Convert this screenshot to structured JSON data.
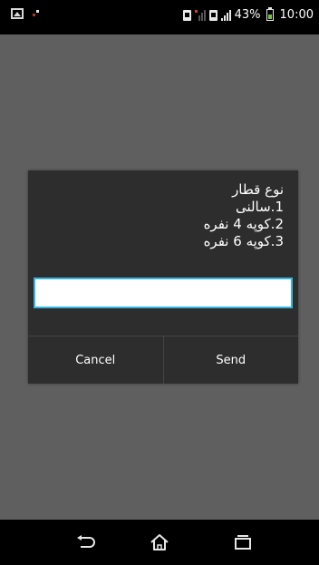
{
  "status_bar": {
    "battery": "43%",
    "time": "10:00",
    "icons": [
      "gallery-icon",
      "notification-icon",
      "sim-icon",
      "signal-icon",
      "battery-icon"
    ]
  },
  "dialog": {
    "message_lines": [
      "نوع قطار",
      "1.سالنی",
      "2.کوپه 4 نفره",
      "3.کوپه 6 نفره"
    ],
    "input": {
      "value": "",
      "placeholder": ""
    },
    "buttons": {
      "cancel": "Cancel",
      "send": "Send"
    },
    "accent_color": "#33b5e5"
  },
  "nav_bar": {
    "icons": [
      "back-icon",
      "home-icon",
      "recent-apps-icon"
    ]
  }
}
